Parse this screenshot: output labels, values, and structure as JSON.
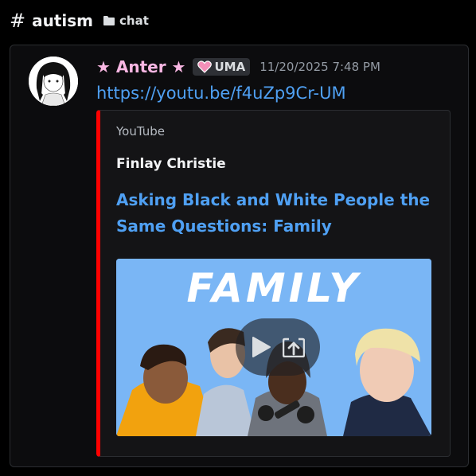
{
  "header": {
    "hash_symbol": "#",
    "channel_name": "autism",
    "folder_label": "chat"
  },
  "message": {
    "username": "★ Anter ★",
    "tag_label": "UMA",
    "timestamp": "11/20/2025 7:48 PM",
    "link_text": "https://youtu.be/f4uZp9Cr-UM"
  },
  "embed": {
    "provider": "YouTube",
    "author": "Finlay Christie",
    "title": "Asking Black and White People the Same Questions: Family",
    "thumbnail_text": "FAMILY",
    "accent_color": "#ff0000"
  },
  "icons": {
    "play": "play-icon",
    "open_external": "open-external-icon",
    "folder": "folder-icon",
    "tag_badge": "heart-badge-icon"
  },
  "colors": {
    "link": "#4fa0f3",
    "username": "#f9b7e3",
    "thumbnail_bg": "#7ab6f5"
  }
}
